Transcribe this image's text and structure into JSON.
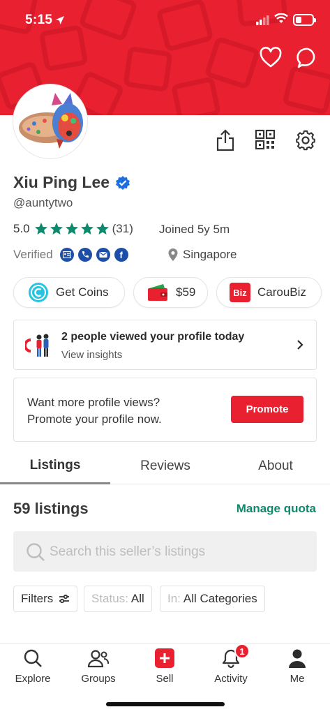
{
  "status_bar": {
    "time": "5:15"
  },
  "profile": {
    "name": "Xiu Ping Lee",
    "handle": "@auntytwo",
    "rating": "5.0",
    "review_count": "(31)",
    "stars": 5,
    "joined": "Joined 5y 5m",
    "verified_label": "Verified",
    "location": "Singapore"
  },
  "pills": {
    "coins": "Get Coins",
    "wallet": "$59",
    "caroubiz_icon": "Biz",
    "caroubiz": "CarouBiz"
  },
  "views_card": {
    "title": "2 people viewed your profile today",
    "subtitle": "View insights"
  },
  "promo_card": {
    "line1": "Want more profile views?",
    "line2": "Promote your profile now.",
    "button": "Promote"
  },
  "tabs": [
    "Listings",
    "Reviews",
    "About"
  ],
  "listings": {
    "count": "59 listings",
    "manage": "Manage quota",
    "search_placeholder": "Search this seller’s listings"
  },
  "filters": {
    "filters_label": "Filters",
    "status_label": "Status:",
    "status_value": "All",
    "in_label": "In:",
    "in_value": "All Categories"
  },
  "bottom_nav": {
    "explore": "Explore",
    "groups": "Groups",
    "sell": "Sell",
    "activity": "Activity",
    "activity_badge": "1",
    "me": "Me"
  },
  "colors": {
    "brand_red": "#e8202f",
    "accent_green": "#0d8a6b",
    "star_green": "#0d8a6b",
    "verify_blue": "#1d4fa8"
  }
}
